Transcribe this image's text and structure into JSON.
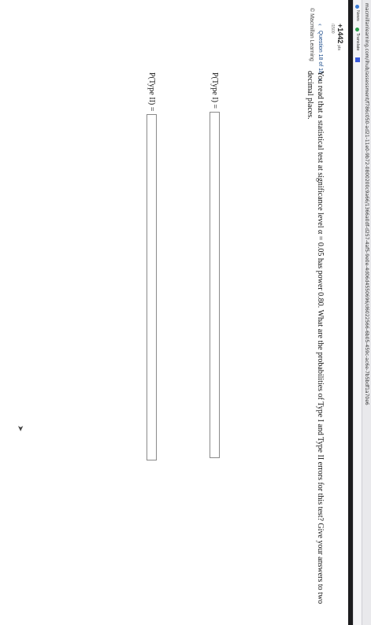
{
  "browser": {
    "url": "macmillanlearning.com/ihub/assessment/f786c050-ad21-11e0-9b72-0800200c9a66/1366a0df-d257-4af5-9e0e-4d06d4550696/d6022566-6b05-459c-ac6e-7b5bdf1a70e6",
    "bookmarks": [
      {
        "label": "News",
        "icon": "news-icon"
      },
      {
        "label": "Translate",
        "icon": "translate-icon"
      },
      {
        "label": "",
        "icon": "bookmark-square-icon"
      }
    ]
  },
  "header": {
    "score": "+1442",
    "score_unit": "pts",
    "score_sub": "/1500"
  },
  "question_nav": {
    "label": "Question 18 of 18",
    "prev_icon": "chevron-left-icon",
    "next_icon": "chevron-right-icon"
  },
  "credit": "© Macmillan Learning",
  "question": {
    "text": "You read that a statistical test at significance level α = 0.05 has power 0.80. What are the probabilities of Type I and Type II errors for this test? Give your answers to two decimal places."
  },
  "answers": [
    {
      "label": "P(Type I) =",
      "value": ""
    },
    {
      "label": "P(Type II) =",
      "value": ""
    }
  ],
  "colors": {
    "accent": "#1a4a8a",
    "dark_band": "#1c1c1e"
  }
}
